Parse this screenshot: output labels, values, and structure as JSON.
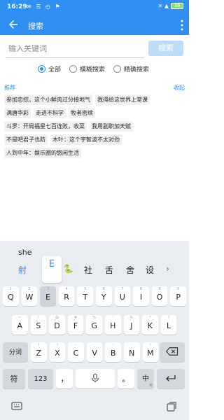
{
  "status": {
    "time": "16:29",
    "left_icons": "✉ ☰ ◴ ⚑",
    "right_icons": "✕ ▲",
    "battery": "36"
  },
  "appbar": {
    "title": "搜索"
  },
  "search": {
    "placeholder": "输入关键词",
    "button_label": "搜索"
  },
  "filters": [
    {
      "label": "全部",
      "checked": true
    },
    {
      "label": "模糊搜索",
      "checked": false
    },
    {
      "label": "精确搜索",
      "checked": false
    }
  ],
  "recommend": {
    "label": "推荐",
    "collapse_label": "收起",
    "tags": [
      [
        "参加恋综，这个小鲜肉过分接地气",
        "我得给这世界上堂课"
      ],
      [
        "满唐华彩",
        "走进不科学",
        "牧者密续"
      ],
      [
        "斗罗：开局福星七百连败，收菜",
        "我用副职加天赋"
      ],
      [
        "不是吧君子也防",
        "木叶：这个宇智波不太对劲"
      ],
      [
        "人到中年：娱乐圈的悠闲生活"
      ]
    ]
  },
  "keyboard": {
    "pinyin": "she",
    "candidates": [
      "射",
      "E",
      "🐍",
      "社",
      "舌",
      "舍",
      "设"
    ],
    "popup": "E",
    "more_icon": "chevron-right-icon",
    "row1": [
      {
        "main": "Q",
        "hint": "1"
      },
      {
        "main": "W",
        "hint": "2"
      },
      {
        "main": "E",
        "hint": "3"
      },
      {
        "main": "R",
        "hint": "4"
      },
      {
        "main": "T",
        "hint": "5"
      },
      {
        "main": "Y",
        "hint": "6"
      },
      {
        "main": "U",
        "hint": "7"
      },
      {
        "main": "I",
        "hint": "8"
      },
      {
        "main": "O",
        "hint": "9"
      },
      {
        "main": "P",
        "hint": "0"
      }
    ],
    "row2": [
      {
        "main": "A",
        "hint": "~"
      },
      {
        "main": "S",
        "hint": "!"
      },
      {
        "main": "D",
        "hint": "@"
      },
      {
        "main": "F",
        "hint": "#"
      },
      {
        "main": "G",
        "hint": "%"
      },
      {
        "main": "H",
        "hint": "'"
      },
      {
        "main": "J",
        "hint": "&"
      },
      {
        "main": "K",
        "hint": "*"
      },
      {
        "main": "L",
        "hint": "?"
      }
    ],
    "row3": [
      {
        "main": "Z",
        "hint": "("
      },
      {
        "main": "X",
        "hint": ")"
      },
      {
        "main": "C",
        "hint": "-"
      },
      {
        "main": "V",
        "hint": "_"
      },
      {
        "main": "B",
        "hint": ":"
      },
      {
        "main": "N",
        "hint": ";"
      },
      {
        "main": "M",
        "hint": "/"
      }
    ],
    "fenci": "分词",
    "symbol": "符",
    "num": "123",
    "comma": "，",
    "period": "。",
    "lang": "中",
    "lang_sub": "英",
    "enter_icon": "enter-icon",
    "backspace_icon": "backspace-icon",
    "space_icon": "microphone-icon"
  }
}
